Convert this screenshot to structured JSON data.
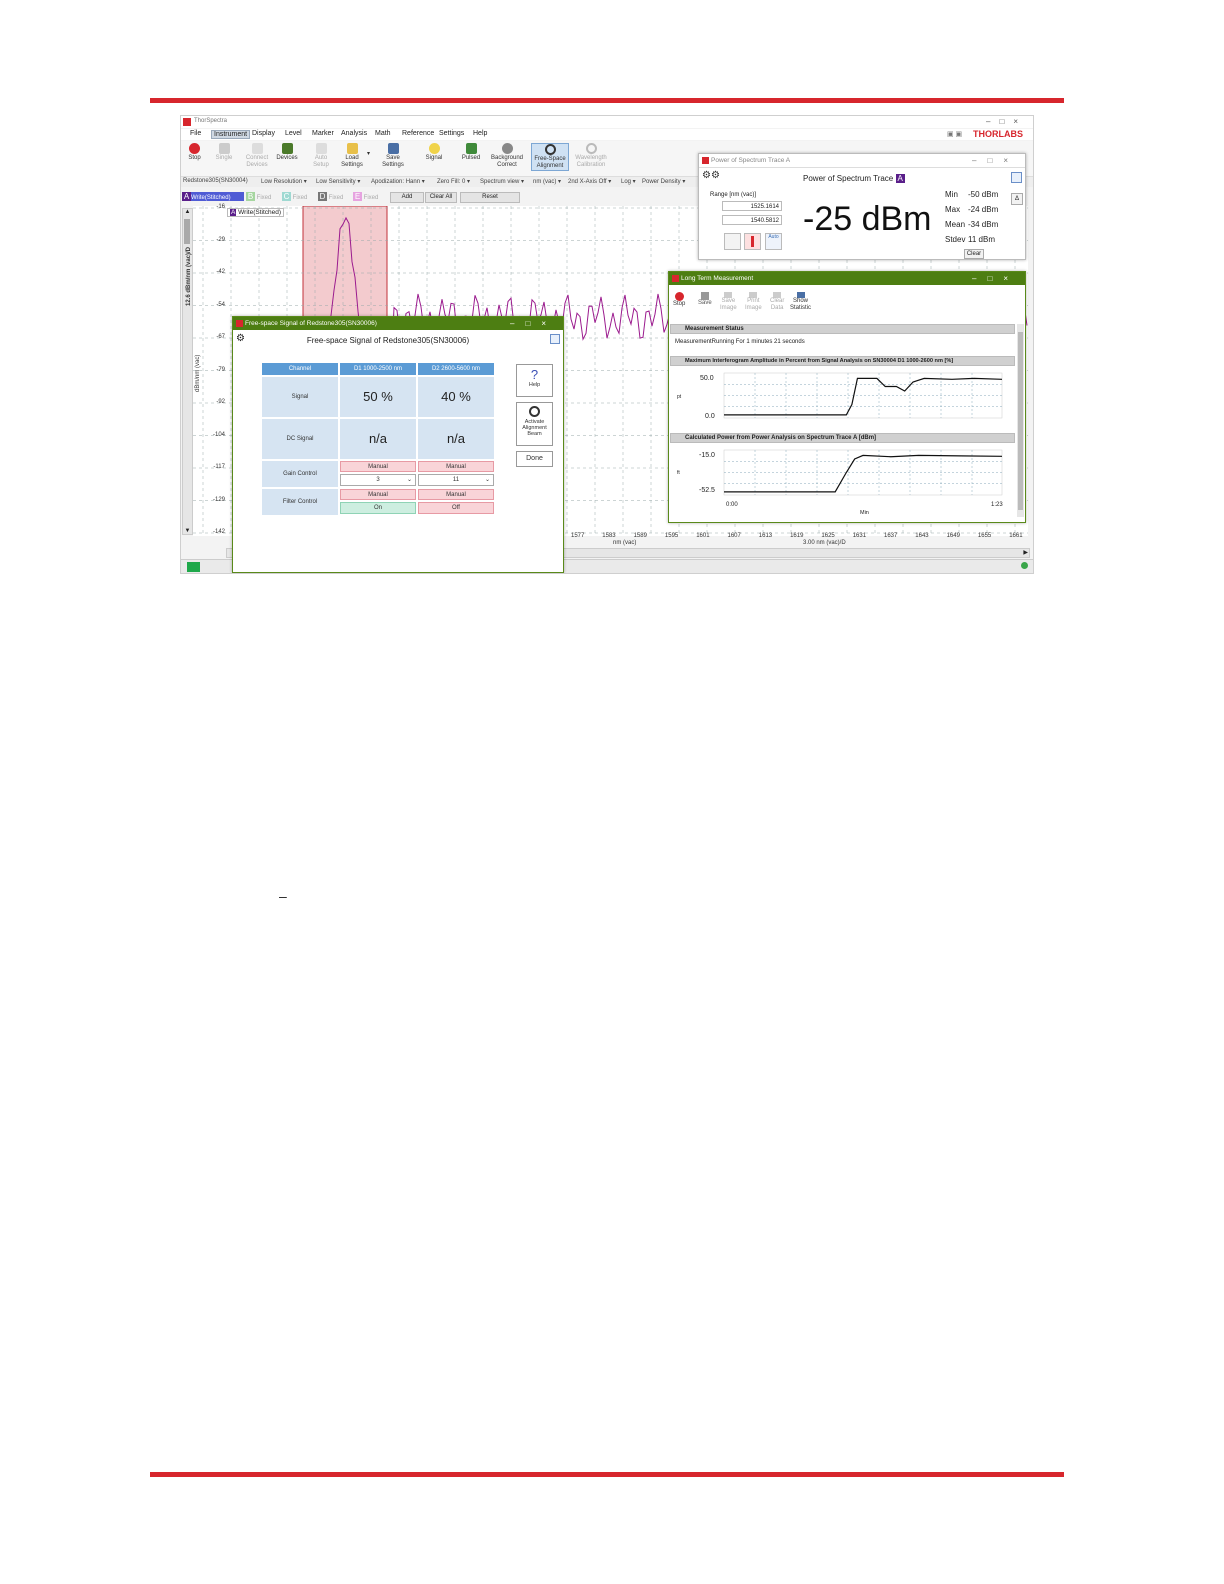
{
  "app": {
    "title": "ThorSpectra",
    "brand_logo": "THORLABS",
    "window_controls": [
      "–",
      "□",
      "×"
    ]
  },
  "menu": [
    "File",
    "Instrument",
    "Display",
    "Level",
    "Marker",
    "Analysis",
    "Math",
    "Reference",
    "Settings",
    "Help"
  ],
  "ribbon": {
    "stop": "Stop",
    "single": "Single",
    "connect_devices": [
      "Connect",
      "Devices"
    ],
    "devices": "Devices",
    "auto_setup": [
      "Auto",
      "Setup"
    ],
    "load_settings": [
      "Load",
      "Settings"
    ],
    "save_settings": [
      "Save",
      "Settings"
    ],
    "signal": "Signal",
    "pulsed": "Pulsed",
    "background_correct": [
      "Background",
      "Correct"
    ],
    "free_space_alignment": [
      "Free-Space",
      "Alignment"
    ],
    "wavelength_calibration": [
      "Wavelength",
      "Calibration"
    ]
  },
  "settings_bar": [
    "Redstone305(SN30004)",
    "Low Resolution ▾",
    "Low Sensitivity ▾",
    "Apodization: Hann ▾",
    "Zero Fill: 0 ▾",
    "Spectrum view ▾",
    "nm (vac) ▾",
    "2nd X-Axis Off ▾",
    "Log ▾",
    "Power Density ▾"
  ],
  "traces": {
    "a_letter": "A",
    "a_label": "Write(Stitched)",
    "b_letter": "B",
    "b_label": "Fixed",
    "c_letter": "C",
    "c_label": "Fixed",
    "d_letter": "D",
    "d_label": "Fixed",
    "e_letter": "E",
    "e_label": "Fixed",
    "add": "Add",
    "clear_all": "Clear All",
    "reset": "Reset",
    "legend_letter": "A",
    "legend_label": "Write(Stitched)"
  },
  "plot": {
    "y_ticks": [
      "-16",
      "-29",
      "-42",
      "-54",
      "-67",
      "-79",
      "-92",
      "-104",
      "-117",
      "-129",
      "-142"
    ],
    "y_axis_label_top": "12.6 dBm/nm (vac)/D",
    "y_axis_label": "dBm/nm (vac)",
    "x_ticks": [
      "1577",
      "1583",
      "1589",
      "1595",
      "1601",
      "1607",
      "1613",
      "1619",
      "1625",
      "1631",
      "1637",
      "1643",
      "1649",
      "1655",
      "1661"
    ],
    "x_axis_label": "nm (vac)",
    "x_axis_div": "3.00 nm (vac)/D",
    "trace_color": "#9b1b8e",
    "highlight_color": "#e58b93"
  },
  "power_window": {
    "title": "Power of Spectrum Trace A",
    "heading": "Power of Spectrum Trace",
    "trace_letter": "A",
    "range_label": "Range [nm (vac)]",
    "range_from": "1525.1614",
    "range_to": "1540.5812",
    "auto_label": "Auto",
    "value": "-25 dBm",
    "stats": [
      {
        "k": "Min",
        "v": "-50 dBm"
      },
      {
        "k": "Max",
        "v": "-24 dBm"
      },
      {
        "k": "Mean",
        "v": "-34 dBm"
      },
      {
        "k": "Stdev",
        "v": "11 dBm"
      }
    ],
    "clear": "Clear"
  },
  "ltm_window": {
    "title": "Long Term Measurement",
    "buttons": {
      "stop": "Stop",
      "save": "Save",
      "save_image": [
        "Save",
        "Image"
      ],
      "print_image": [
        "Print",
        "Image"
      ],
      "clear_data": [
        "Clear",
        "Data"
      ],
      "show_statistic": [
        "Show",
        "Statistic"
      ]
    },
    "status_header": "Measurement Status",
    "status_text": "MeasurementRunning For 1 minutes 21 seconds",
    "chart1_header": "Maximum Interferogram Amplitude in Percent from Signal Analysis on SN30004 D1 1000-2600 nm [%]",
    "chart1_ymax": "50.0",
    "chart1_ymin": "0.0",
    "chart1_ylabel": "pt",
    "chart2_header": "Calculated Power from Power Analysis on Spectrum Trace A [dBm]",
    "chart2_ymax": "-15.0",
    "chart2_ymin": "-52.5",
    "chart2_ylabel": "ft",
    "x_start": "0:00",
    "x_end": "1:23",
    "x_label": "Min"
  },
  "fs_window": {
    "title": "Free-space Signal of Redstone305(SN30006)",
    "heading": "Free-space Signal of Redstone305(SN30006)",
    "col_channel": "Channel",
    "col_d1": "D1 1000-2500 nm",
    "col_d2": "D2 2600-5600 nm",
    "row_signal": "Signal",
    "signal_d1": "50 %",
    "signal_d2": "40 %",
    "row_dc": "DC Signal",
    "dc_d1": "n/a",
    "dc_d2": "n/a",
    "row_gain": "Gain Control",
    "gain_mode_d1": "Manual",
    "gain_mode_d2": "Manual",
    "gain_val_d1": "3",
    "gain_val_d2": "11",
    "row_filter": "Filter Control",
    "filter_mode_d1": "Manual",
    "filter_mode_d2": "Manual",
    "filter_d1": "On",
    "filter_d2": "Off",
    "help_icon": "?",
    "help": "Help",
    "activate": [
      "Activate",
      "Alignment",
      "Beam"
    ],
    "done": "Done"
  },
  "page_note": "–"
}
